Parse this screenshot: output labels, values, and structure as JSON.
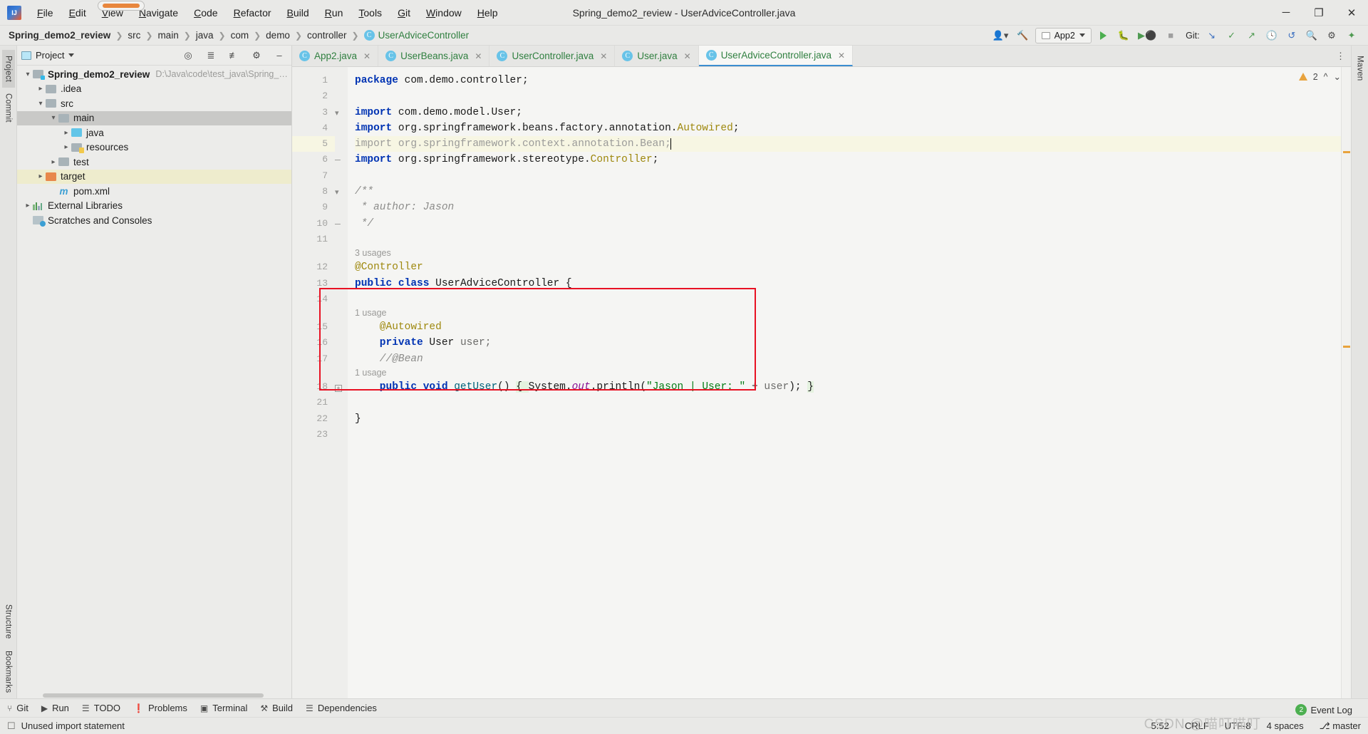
{
  "window": {
    "title": "Spring_demo2_review - UserAdviceController.java",
    "logo": "intellij-idea-logo",
    "controls": {
      "minimize": "─",
      "maximize": "❐",
      "close": "✕"
    }
  },
  "menu": [
    {
      "label": "File",
      "mnemonic": "F"
    },
    {
      "label": "Edit",
      "mnemonic": "E"
    },
    {
      "label": "View",
      "mnemonic": "V"
    },
    {
      "label": "Navigate",
      "mnemonic": "N"
    },
    {
      "label": "Code",
      "mnemonic": "C"
    },
    {
      "label": "Refactor",
      "mnemonic": "R"
    },
    {
      "label": "Build",
      "mnemonic": "B"
    },
    {
      "label": "Run",
      "mnemonic": "R"
    },
    {
      "label": "Tools",
      "mnemonic": "T"
    },
    {
      "label": "Git",
      "mnemonic": "G"
    },
    {
      "label": "Window",
      "mnemonic": "W"
    },
    {
      "label": "Help",
      "mnemonic": "H"
    }
  ],
  "navbar": {
    "crumbs": [
      "Spring_demo2_review",
      "src",
      "main",
      "java",
      "com",
      "demo",
      "controller"
    ],
    "active_crumb": "UserAdviceController",
    "run_config": "App2",
    "git_label": "Git:"
  },
  "project_panel": {
    "title": "Project",
    "tree": [
      {
        "label": "Spring_demo2_review",
        "path": "D:\\Java\\code\\test_java\\Spring_demo",
        "depth": 0,
        "arrow": "open",
        "icon": "folder-module",
        "bold": true,
        "state": ""
      },
      {
        "label": ".idea",
        "path": "",
        "depth": 1,
        "arrow": "closed",
        "icon": "folder-grey",
        "bold": false,
        "state": ""
      },
      {
        "label": "src",
        "path": "",
        "depth": 1,
        "arrow": "open",
        "icon": "folder-grey",
        "bold": false,
        "state": ""
      },
      {
        "label": "main",
        "path": "",
        "depth": 2,
        "arrow": "open",
        "icon": "folder-grey",
        "bold": false,
        "state": "selected"
      },
      {
        "label": "java",
        "path": "",
        "depth": 3,
        "arrow": "closed",
        "icon": "folder-blue",
        "bold": false,
        "state": ""
      },
      {
        "label": "resources",
        "path": "",
        "depth": 3,
        "arrow": "closed",
        "icon": "folder-resources",
        "bold": false,
        "state": ""
      },
      {
        "label": "test",
        "path": "",
        "depth": 2,
        "arrow": "closed",
        "icon": "folder-grey",
        "bold": false,
        "state": ""
      },
      {
        "label": "target",
        "path": "",
        "depth": 1,
        "arrow": "closed",
        "icon": "folder-orange",
        "bold": false,
        "state": "highlight"
      },
      {
        "label": "pom.xml",
        "path": "",
        "depth": 2,
        "arrow": "none",
        "icon": "maven-icon",
        "bold": false,
        "state": ""
      },
      {
        "label": "External Libraries",
        "path": "",
        "depth": 0,
        "arrow": "closed",
        "icon": "library-icon",
        "bold": false,
        "state": ""
      },
      {
        "label": "Scratches and Consoles",
        "path": "",
        "depth": 0,
        "arrow": "none",
        "icon": "scratches-icon",
        "bold": false,
        "state": ""
      }
    ]
  },
  "left_rail": [
    "Project",
    "Commit",
    "Structure",
    "Bookmarks"
  ],
  "right_rail": [
    "Maven"
  ],
  "tabs": [
    {
      "label": "App2.java",
      "active": false
    },
    {
      "label": "UserBeans.java",
      "active": false
    },
    {
      "label": "UserController.java",
      "active": false
    },
    {
      "label": "User.java",
      "active": false
    },
    {
      "label": "UserAdviceController.java",
      "active": true
    }
  ],
  "inspection": {
    "warning_count": "2"
  },
  "editor": {
    "lines": [
      {
        "num": "1",
        "kind": "code",
        "highlight": false,
        "fold": "",
        "tokens": [
          {
            "t": "package ",
            "c": "kw"
          },
          {
            "t": "com.demo.controller;",
            "c": "typ"
          }
        ]
      },
      {
        "num": "2",
        "kind": "code",
        "highlight": false,
        "fold": "",
        "tokens": []
      },
      {
        "num": "3",
        "kind": "code",
        "highlight": false,
        "fold": "import-start",
        "tokens": [
          {
            "t": "import ",
            "c": "kw"
          },
          {
            "t": "com.demo.model.User;",
            "c": "typ"
          }
        ]
      },
      {
        "num": "4",
        "kind": "code",
        "highlight": false,
        "fold": "",
        "tokens": [
          {
            "t": "import ",
            "c": "kw"
          },
          {
            "t": "org.springframework.beans.factory.annotation.",
            "c": "typ"
          },
          {
            "t": "Autowired",
            "c": "ann"
          },
          {
            "t": ";",
            "c": "typ"
          }
        ]
      },
      {
        "num": "5",
        "kind": "code",
        "highlight": true,
        "fold": "",
        "tokens": [
          {
            "t": "import ",
            "c": "dim"
          },
          {
            "t": "org.springframework.context.annotation.",
            "c": "dim"
          },
          {
            "t": "Bean",
            "c": "dim"
          },
          {
            "t": ";",
            "c": "dim"
          },
          {
            "t": "|",
            "c": "caret"
          }
        ]
      },
      {
        "num": "6",
        "kind": "code",
        "highlight": false,
        "fold": "import-end",
        "tokens": [
          {
            "t": "import ",
            "c": "kw"
          },
          {
            "t": "org.springframework.stereotype.",
            "c": "typ"
          },
          {
            "t": "Controller",
            "c": "ann"
          },
          {
            "t": ";",
            "c": "typ"
          }
        ]
      },
      {
        "num": "7",
        "kind": "code",
        "highlight": false,
        "fold": "",
        "tokens": []
      },
      {
        "num": "8",
        "kind": "code",
        "highlight": false,
        "fold": "doc-start",
        "tokens": [
          {
            "t": "/**",
            "c": "cmt"
          }
        ]
      },
      {
        "num": "9",
        "kind": "code",
        "highlight": false,
        "fold": "",
        "tokens": [
          {
            "t": " * author: Jason",
            "c": "cmt"
          }
        ]
      },
      {
        "num": "10",
        "kind": "code",
        "highlight": false,
        "fold": "doc-end",
        "tokens": [
          {
            "t": " */",
            "c": "cmt"
          }
        ]
      },
      {
        "num": "11",
        "kind": "code",
        "highlight": false,
        "fold": "",
        "tokens": []
      },
      {
        "num": "",
        "kind": "hint",
        "highlight": false,
        "fold": "",
        "text": "3 usages"
      },
      {
        "num": "12",
        "kind": "code",
        "highlight": false,
        "fold": "",
        "tokens": [
          {
            "t": "@Controller",
            "c": "ann"
          }
        ]
      },
      {
        "num": "13",
        "kind": "code",
        "highlight": false,
        "fold": "",
        "tokens": [
          {
            "t": "public ",
            "c": "kw"
          },
          {
            "t": "class ",
            "c": "kw"
          },
          {
            "t": "UserAdviceController",
            "c": "typ"
          },
          {
            "t": " {",
            "c": "typ"
          }
        ]
      },
      {
        "num": "14",
        "kind": "code",
        "highlight": false,
        "fold": "",
        "tokens": []
      },
      {
        "num": "",
        "kind": "hint",
        "highlight": false,
        "fold": "",
        "text": "1 usage"
      },
      {
        "num": "15",
        "kind": "code",
        "highlight": false,
        "fold": "",
        "tokens": [
          {
            "t": "    @Autowired",
            "c": "ann"
          }
        ]
      },
      {
        "num": "16",
        "kind": "code",
        "highlight": false,
        "fold": "",
        "tokens": [
          {
            "t": "    private ",
            "c": "kw"
          },
          {
            "t": "User ",
            "c": "typ"
          },
          {
            "t": "user;",
            "c": "var"
          }
        ]
      },
      {
        "num": "17",
        "kind": "code",
        "highlight": false,
        "fold": "",
        "tokens": [
          {
            "t": "    //@Bean",
            "c": "cmt"
          }
        ]
      },
      {
        "num": "",
        "kind": "hint",
        "highlight": false,
        "fold": "",
        "text": "1 usage"
      },
      {
        "num": "18",
        "kind": "code",
        "highlight": false,
        "fold": "method",
        "tokens": [
          {
            "t": "    public ",
            "c": "kw"
          },
          {
            "t": "void ",
            "c": "kw"
          },
          {
            "t": "getUser",
            "c": "mth"
          },
          {
            "t": "() ",
            "c": "typ"
          },
          {
            "t": "{ ",
            "c": "brace"
          },
          {
            "t": "System.",
            "c": "typ"
          },
          {
            "t": "out",
            "c": "fld"
          },
          {
            "t": ".println(",
            "c": "typ"
          },
          {
            "t": "\"Jason | User: \"",
            "c": "str"
          },
          {
            "t": " + ",
            "c": "typ"
          },
          {
            "t": "user",
            "c": "var"
          },
          {
            "t": "); ",
            "c": "typ"
          },
          {
            "t": "}",
            "c": "brace"
          }
        ]
      },
      {
        "num": "21",
        "kind": "code",
        "highlight": false,
        "fold": "",
        "tokens": []
      },
      {
        "num": "22",
        "kind": "code",
        "highlight": false,
        "fold": "",
        "tokens": [
          {
            "t": "}",
            "c": "typ"
          }
        ]
      },
      {
        "num": "23",
        "kind": "code",
        "highlight": false,
        "fold": "",
        "tokens": []
      }
    ]
  },
  "bottom_toolbar": [
    {
      "label": "Git",
      "icon": "git-branch-icon"
    },
    {
      "label": "Run",
      "icon": "run-icon"
    },
    {
      "label": "TODO",
      "icon": "todo-list-icon"
    },
    {
      "label": "Problems",
      "icon": "problems-icon"
    },
    {
      "label": "Terminal",
      "icon": "terminal-icon"
    },
    {
      "label": "Build",
      "icon": "build-hammer-icon"
    },
    {
      "label": "Dependencies",
      "icon": "dependencies-icon"
    }
  ],
  "statusbar": {
    "message": "Unused import statement",
    "caret": "5:52",
    "line_separator": "CRLF",
    "encoding": "UTF-8",
    "indent": "4 spaces",
    "branch": "master",
    "event_log": "Event Log",
    "event_count": "2",
    "watermark": "CSDN @喵叮喵叮"
  },
  "colors": {
    "accent": "#3b8ed0",
    "annotation": "#9e880d",
    "keyword": "#0033b3",
    "string": "#067d17",
    "warning": "#e8a33d",
    "error": "#e81123",
    "green": "#4caf50"
  }
}
